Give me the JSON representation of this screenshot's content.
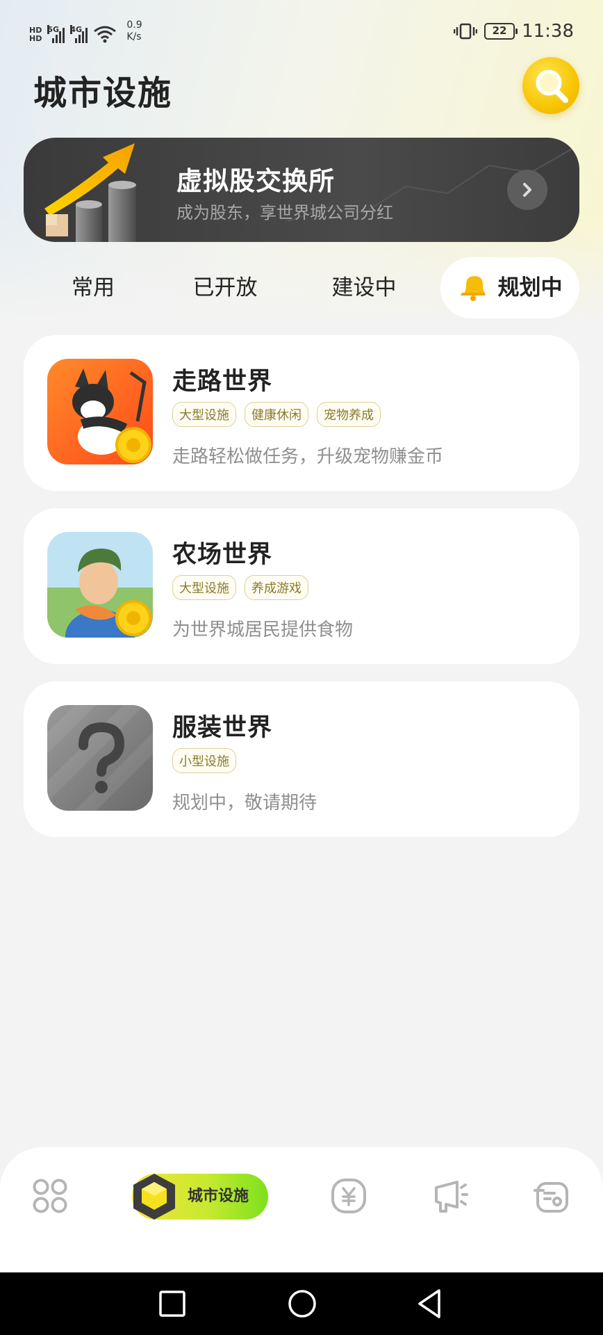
{
  "status_bar": {
    "hd_top": "HD",
    "hd_bottom": "HD",
    "net1": "5G",
    "net2": "4G",
    "speed_value": "0.9",
    "speed_unit": "K/s",
    "battery": "22",
    "time": "11:38"
  },
  "header": {
    "title": "城市设施",
    "search_icon": "search-magnifier-icon"
  },
  "banner": {
    "title": "虚拟股交换所",
    "subtitle": "成为股东，享世界城公司分红"
  },
  "tabs": [
    {
      "label": "常用",
      "active": false
    },
    {
      "label": "已开放",
      "active": false
    },
    {
      "label": "建设中",
      "active": false
    },
    {
      "label": "规划中",
      "active": true
    }
  ],
  "facilities": [
    {
      "title": "走路世界",
      "tags": [
        "大型设施",
        "健康休闲",
        "宠物养成"
      ],
      "desc": "走路轻松做任务，升级宠物赚金币",
      "icon": "walking-dog-icon"
    },
    {
      "title": "农场世界",
      "tags": [
        "大型设施",
        "养成游戏"
      ],
      "desc": "为世界城居民提供食物",
      "icon": "farmer-icon"
    },
    {
      "title": "服装世界",
      "tags": [
        "小型设施"
      ],
      "desc": "规划中，敬请期待",
      "icon": "question-mark-icon"
    }
  ],
  "bottom_nav": {
    "items": [
      {
        "icon": "grid-apps-icon",
        "active": false
      },
      {
        "icon": "city-cube-icon",
        "label": "城市设施",
        "active": true
      },
      {
        "icon": "yuan-coin-icon",
        "active": false
      },
      {
        "icon": "megaphone-icon",
        "active": false
      },
      {
        "icon": "message-box-icon",
        "active": false
      }
    ]
  },
  "colors": {
    "accent_yellow": "#f7c500",
    "active_tab_gradient_start": "#f5e33b",
    "active_tab_gradient_end": "#7ce11d",
    "tag_text": "#8a7a2c",
    "banner_bg": "#3a3a3a"
  }
}
